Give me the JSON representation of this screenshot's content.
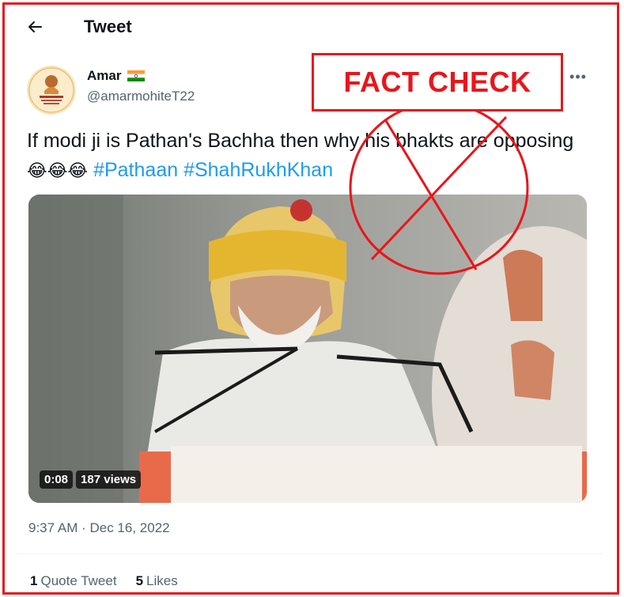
{
  "header": {
    "title": "Tweet",
    "back_icon": "arrow-left-icon"
  },
  "author": {
    "name": "Amar",
    "handle": "@amarmohiteT22",
    "flag_icon": "india-flag-icon"
  },
  "overlay": {
    "fact_check_label": "FACT CHECK",
    "color": "#e8161a"
  },
  "tweet": {
    "text": "If modi ji is Pathan's Bachha then why his bhakts are opposing",
    "emojis": "😂😂😂",
    "hashtags": [
      "#Pathaan",
      "#ShahRukhKhan"
    ],
    "hashtag_color": "#1d9bf0",
    "timestamp": "9:37 AM · Dec 16, 2022"
  },
  "video": {
    "duration": "0:08",
    "views": "187 views"
  },
  "stats": {
    "quote_count": "1",
    "quote_label": "Quote Tweet",
    "likes_count": "5",
    "likes_label": "Likes"
  }
}
